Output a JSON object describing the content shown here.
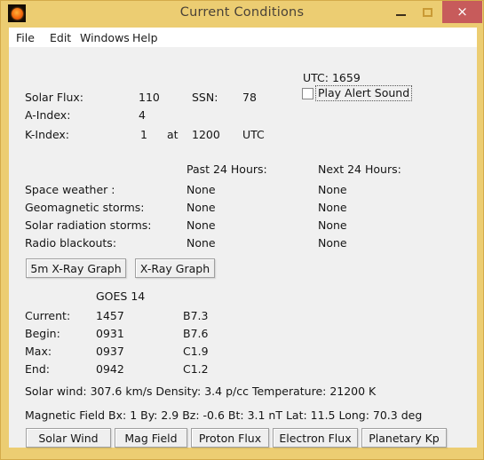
{
  "window": {
    "title": "Current Conditions",
    "icon": "sun-icon",
    "controls": {
      "minimize": "–",
      "maximize": "□",
      "close": "×"
    },
    "colors": {
      "titlebar": "#eccd72",
      "close_button": "#c75b5b",
      "client": "#f0f0f0"
    }
  },
  "menubar": {
    "items": [
      {
        "label": "File"
      },
      {
        "label": "Edit"
      },
      {
        "label": "Windows"
      },
      {
        "label": "Help"
      }
    ]
  },
  "indices": {
    "utc_time": "UTC: 1659",
    "alert_checkbox_label": "Play Alert Sound",
    "alert_checked": false,
    "solar_flux_label": "Solar Flux:",
    "solar_flux_value": "110",
    "ssn_label": "SSN:",
    "ssn_value": "78",
    "a_index_label": "A-Index:",
    "a_index_value": "4",
    "k_index_label": "K-Index:",
    "k_index_value": "1",
    "k_index_at": "at",
    "k_index_time": "1200",
    "k_index_unit": "UTC"
  },
  "conditions": {
    "col_past": "Past 24 Hours:",
    "col_next": "Next 24 Hours:",
    "rows": [
      {
        "label": "Space weather :",
        "past": "None",
        "next": "None"
      },
      {
        "label": "Geomagnetic storms:",
        "past": "None",
        "next": "None"
      },
      {
        "label": "Solar radiation storms:",
        "past": "None",
        "next": "None"
      },
      {
        "label": "Radio blackouts:",
        "past": "None",
        "next": "None"
      }
    ]
  },
  "xray_buttons": {
    "five_min": "5m X-Ray Graph",
    "xray": "X-Ray Graph"
  },
  "goes": {
    "satellite": "GOES 14",
    "rows": [
      {
        "label": "Current:",
        "time": "1457",
        "class": "B7.3"
      },
      {
        "label": "Begin:",
        "time": "0931",
        "class": "B7.6"
      },
      {
        "label": "Max:",
        "time": "0937",
        "class": "C1.9"
      },
      {
        "label": "End:",
        "time": "0942",
        "class": "C1.2"
      }
    ]
  },
  "solar_wind_line": "Solar wind: 307.6 km/s  Density: 3.4 p/cc  Temperature: 21200 K",
  "magnetic_field_line": "Magnetic Field  Bx: 1  By: 2.9  Bz: -0.6  Bt: 3.1 nT  Lat: 11.5  Long: 70.3 deg",
  "bottom_buttons": [
    {
      "label": "Solar Wind"
    },
    {
      "label": "Mag Field"
    },
    {
      "label": "Proton Flux"
    },
    {
      "label": "Electron Flux"
    },
    {
      "label": "Planetary Kp"
    }
  ]
}
